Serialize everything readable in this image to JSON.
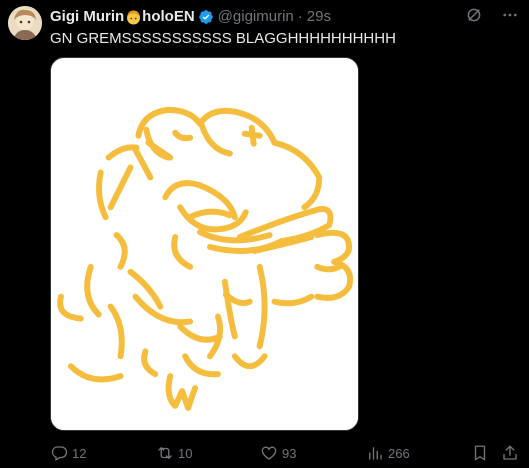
{
  "tweet": {
    "display_name": "Gigi Murin",
    "display_name_suffix": "holoEN",
    "handle": "@gigimurin",
    "separator": "·",
    "time": "29s",
    "text": "GN GREMSSSSSSSSSSS BLAGGHHHHHHHHHH"
  },
  "actions": {
    "replies": "12",
    "reposts": "10",
    "likes": "93",
    "views": "266"
  },
  "icons": {
    "verified": "verified-badge-icon",
    "emoji": "girl-emoji-icon",
    "grok": "grok-icon",
    "more": "more-icon",
    "reply": "reply-icon",
    "repost": "repost-icon",
    "like": "heart-icon",
    "views": "views-icon",
    "bookmark": "bookmark-icon",
    "share": "share-icon"
  },
  "colors": {
    "background": "#000000",
    "text": "#e7e9ea",
    "muted": "#71767b",
    "verified": "#1d9bf0",
    "drawing": "#f5b82e"
  }
}
